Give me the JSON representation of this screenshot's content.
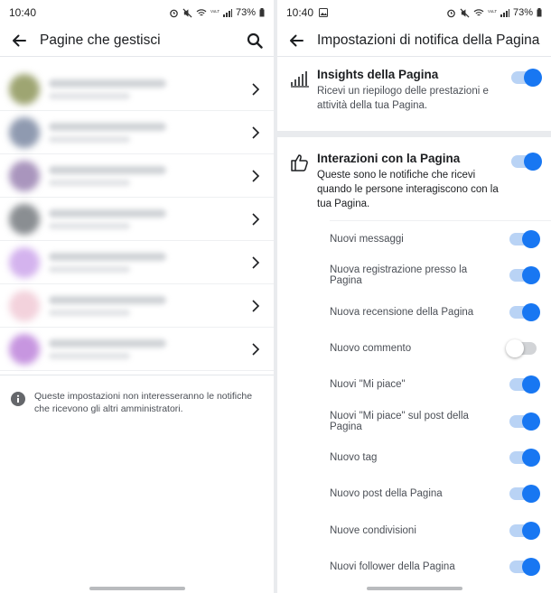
{
  "left": {
    "status": {
      "time": "10:40",
      "battery": "73%"
    },
    "header": {
      "title": "Pagine che gestisci"
    },
    "pages": [
      {
        "avatar_color": "#9ea572"
      },
      {
        "avatar_color": "#8f9ab0"
      },
      {
        "avatar_color": "#a995bd"
      },
      {
        "avatar_color": "#8a8e92"
      },
      {
        "avatar_color": "#d4b3ee"
      },
      {
        "avatar_color": "#f3d2dc"
      },
      {
        "avatar_color": "#c796e0"
      }
    ],
    "notice": "Queste impostazioni non interesseranno le notifiche che ricevono gli altri amministratori."
  },
  "right": {
    "status": {
      "time": "10:40",
      "battery": "73%"
    },
    "header": {
      "title": "Impostazioni di notifica della Pagina"
    },
    "insights": {
      "title": "Insights della Pagina",
      "desc": "Ricevi un riepilogo delle prestazioni e attività della tua Pagina.",
      "on": true
    },
    "interactions": {
      "title": "Interazioni con la Pagina",
      "desc": "Queste sono le notifiche che ricevi quando le persone interagiscono con la tua Pagina.",
      "on": true,
      "items": [
        {
          "label": "Nuovi messaggi",
          "on": true
        },
        {
          "label": "Nuova registrazione presso la Pagina",
          "on": true
        },
        {
          "label": "Nuova recensione della Pagina",
          "on": true
        },
        {
          "label": "Nuovo commento",
          "on": false
        },
        {
          "label": "Nuovi \"Mi piace\"",
          "on": true
        },
        {
          "label": "Nuovi \"Mi piace\" sul post della Pagina",
          "on": true
        },
        {
          "label": "Nuovo tag",
          "on": true
        },
        {
          "label": "Nuovo post della Pagina",
          "on": true
        },
        {
          "label": "Nuove condivisioni",
          "on": true
        },
        {
          "label": "Nuovi follower della Pagina",
          "on": true
        }
      ]
    }
  }
}
